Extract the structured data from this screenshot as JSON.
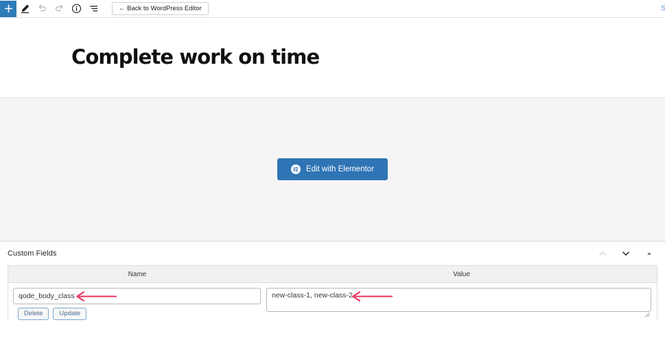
{
  "toolbar": {
    "add_block_label": "+",
    "add_block_icon": "plus-icon",
    "tools": [
      {
        "icon": "pencil-icon",
        "name": "edit-tool",
        "disabled": false
      },
      {
        "icon": "undo-icon",
        "name": "undo-button",
        "disabled": true
      },
      {
        "icon": "redo-icon",
        "name": "redo-button",
        "disabled": true
      },
      {
        "icon": "info-circle-icon",
        "name": "details-button",
        "disabled": false
      },
      {
        "icon": "list-view-icon",
        "name": "list-view-button",
        "disabled": false
      }
    ],
    "back_button_label": "← Back to WordPress Editor",
    "switch_link_label": "Sw",
    "accent_color": "#2e7cb8",
    "link_color": "#5a93d4"
  },
  "post": {
    "title": "Complete work on time"
  },
  "elementor": {
    "button_label": "Edit with Elementor",
    "button_icon": "elementor-logo-icon",
    "button_color": "#2f74b5",
    "panel_background": "#f5f5f5"
  },
  "custom_fields": {
    "panel_title": "Custom Fields",
    "controls": [
      {
        "name": "move-up-button",
        "icon": "chevron-up-icon",
        "disabled": true
      },
      {
        "name": "move-down-button",
        "icon": "chevron-down-icon",
        "disabled": false
      },
      {
        "name": "toggle-panel-button",
        "icon": "caret-up-icon",
        "disabled": false
      }
    ],
    "columns": [
      "Name",
      "Value"
    ],
    "rows": [
      {
        "name_value": "qode_body_class",
        "value_value": "new-class-1, new-class-2",
        "delete_label": "Delete",
        "update_label": "Update"
      }
    ]
  },
  "annotations": {
    "arrow_color": "#e8315c",
    "arrows": [
      {
        "name": "annotation-arrow-name-field",
        "target": "name-input"
      },
      {
        "name": "annotation-arrow-value-field",
        "target": "value-textarea"
      }
    ]
  }
}
